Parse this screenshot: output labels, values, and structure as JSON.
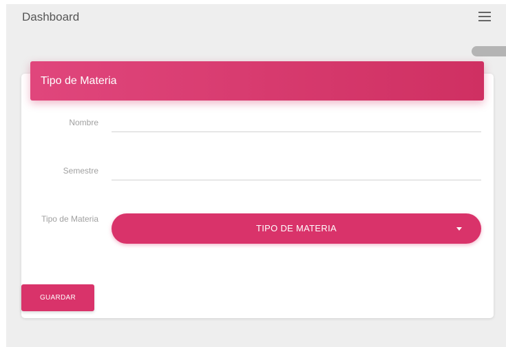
{
  "topbar": {
    "title": "Dashboard",
    "menu_icon": "hamburger-menu-icon"
  },
  "card": {
    "header_title": "Tipo de Materia",
    "fields": {
      "nombre_label": "Nombre",
      "nombre_value": "",
      "semestre_label": "Semestre",
      "semestre_value": "",
      "tipo_label": "Tipo de Materia",
      "tipo_select_text": "TIPO DE MATERIA"
    },
    "save_label": "GUARDAR"
  },
  "colors": {
    "accent": "#d9336a",
    "header_start": "#e0467c",
    "header_end": "#cf3062",
    "background": "#eeeeee"
  }
}
